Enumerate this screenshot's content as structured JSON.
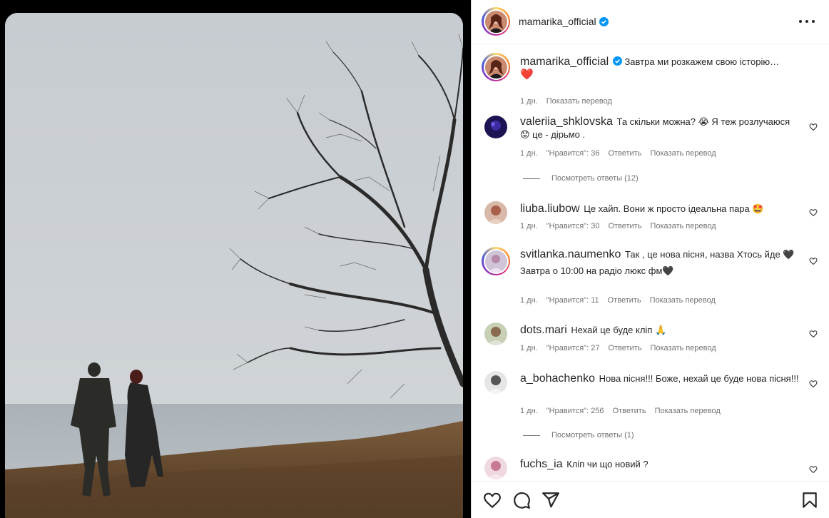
{
  "post": {
    "author": "mamarika_official",
    "caption": "Завтра ми розкажем свою історію…",
    "caption_emoji": "❤️",
    "age": "1 дн.",
    "translate": "Показать перевод"
  },
  "labels": {
    "likes_prefix": "\"Нравится\":",
    "reply": "Ответить",
    "translate": "Показать перевод",
    "view_replies_prefix": "Посмотреть ответы"
  },
  "comments": [
    {
      "user": "valeriia_shklovska",
      "text": "Та скільки можна? 😭 Я теж розлучаюся 😟 це - дірьмо .",
      "age": "1 дн.",
      "likes": "\"Нравится\": 36",
      "reply": "Ответить",
      "translate": "Показать перевод",
      "replies": "Посмотреть ответы (12)"
    },
    {
      "user": "liuba.liubow",
      "text": "Це хайп. Вони ж просто ідеальна пара 🤩",
      "age": "1 дн.",
      "likes": "\"Нравится\": 30",
      "reply": "Ответить",
      "translate": "Показать перевод"
    },
    {
      "user": "svitlanka.naumenko",
      "text": "Так , це нова пісня, назва Хтось йде 🖤",
      "text2": "Завтра о 10:00 на радіо люкс фм🖤",
      "age": "1 дн.",
      "likes": "\"Нравится\": 11",
      "reply": "Ответить",
      "translate": "Показать перевод"
    },
    {
      "user": "dots.mari",
      "text": "Нехай це буде кліп 🙏",
      "age": "1 дн.",
      "likes": "\"Нравится\": 27",
      "reply": "Ответить",
      "translate": "Показать перевод"
    },
    {
      "user": "a_bohachenko",
      "text": "Нова пісня!!! Боже, нехай це буде нова пісня!!!",
      "age": "1 дн.",
      "likes": "\"Нравится\": 256",
      "reply": "Ответить",
      "translate": "Показать перевод",
      "replies": "Посмотреть ответы (1)"
    },
    {
      "user": "fuchs_ia",
      "text": "Кліп чи що новий ?"
    }
  ],
  "icons": {
    "more": "more-horizontal-icon",
    "like": "heart-icon",
    "comment": "comment-icon",
    "share": "paper-plane-icon",
    "save": "bookmark-icon",
    "verified": "verified-badge-icon"
  },
  "colors": {
    "verified": "#0095f6",
    "meta_text": "#737373",
    "heart_red": "#e0245e"
  }
}
